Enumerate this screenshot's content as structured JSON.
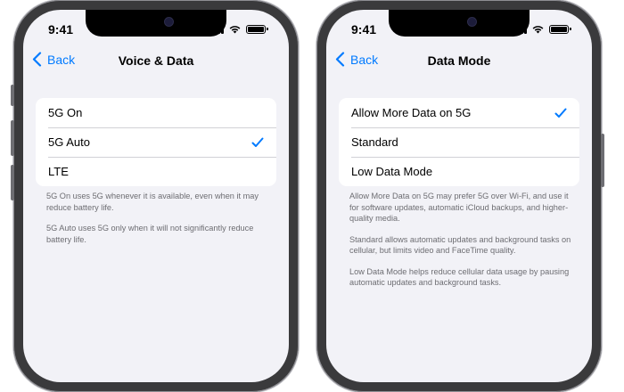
{
  "colors": {
    "accent": "#007aff",
    "background": "#f2f2f7",
    "footer_text": "#6d6d72"
  },
  "left_phone": {
    "status_time": "9:41",
    "back_label": "Back",
    "title": "Voice & Data",
    "options": [
      {
        "label": "5G On",
        "selected": false
      },
      {
        "label": "5G Auto",
        "selected": true
      },
      {
        "label": "LTE",
        "selected": false
      }
    ],
    "footer": [
      "5G On uses 5G whenever it is available, even when it may reduce battery life.",
      "5G Auto uses 5G only when it will not significantly reduce battery life."
    ]
  },
  "right_phone": {
    "status_time": "9:41",
    "back_label": "Back",
    "title": "Data Mode",
    "options": [
      {
        "label": "Allow More Data on 5G",
        "selected": true
      },
      {
        "label": "Standard",
        "selected": false
      },
      {
        "label": "Low Data Mode",
        "selected": false
      }
    ],
    "footer": [
      "Allow More Data on 5G may prefer 5G over Wi-Fi, and use it for software updates, automatic iCloud backups, and higher-quality media.",
      "Standard allows automatic updates and background tasks on cellular, but limits video and FaceTime quality.",
      "Low Data Mode helps reduce cellular data usage by pausing automatic updates and background tasks."
    ]
  }
}
